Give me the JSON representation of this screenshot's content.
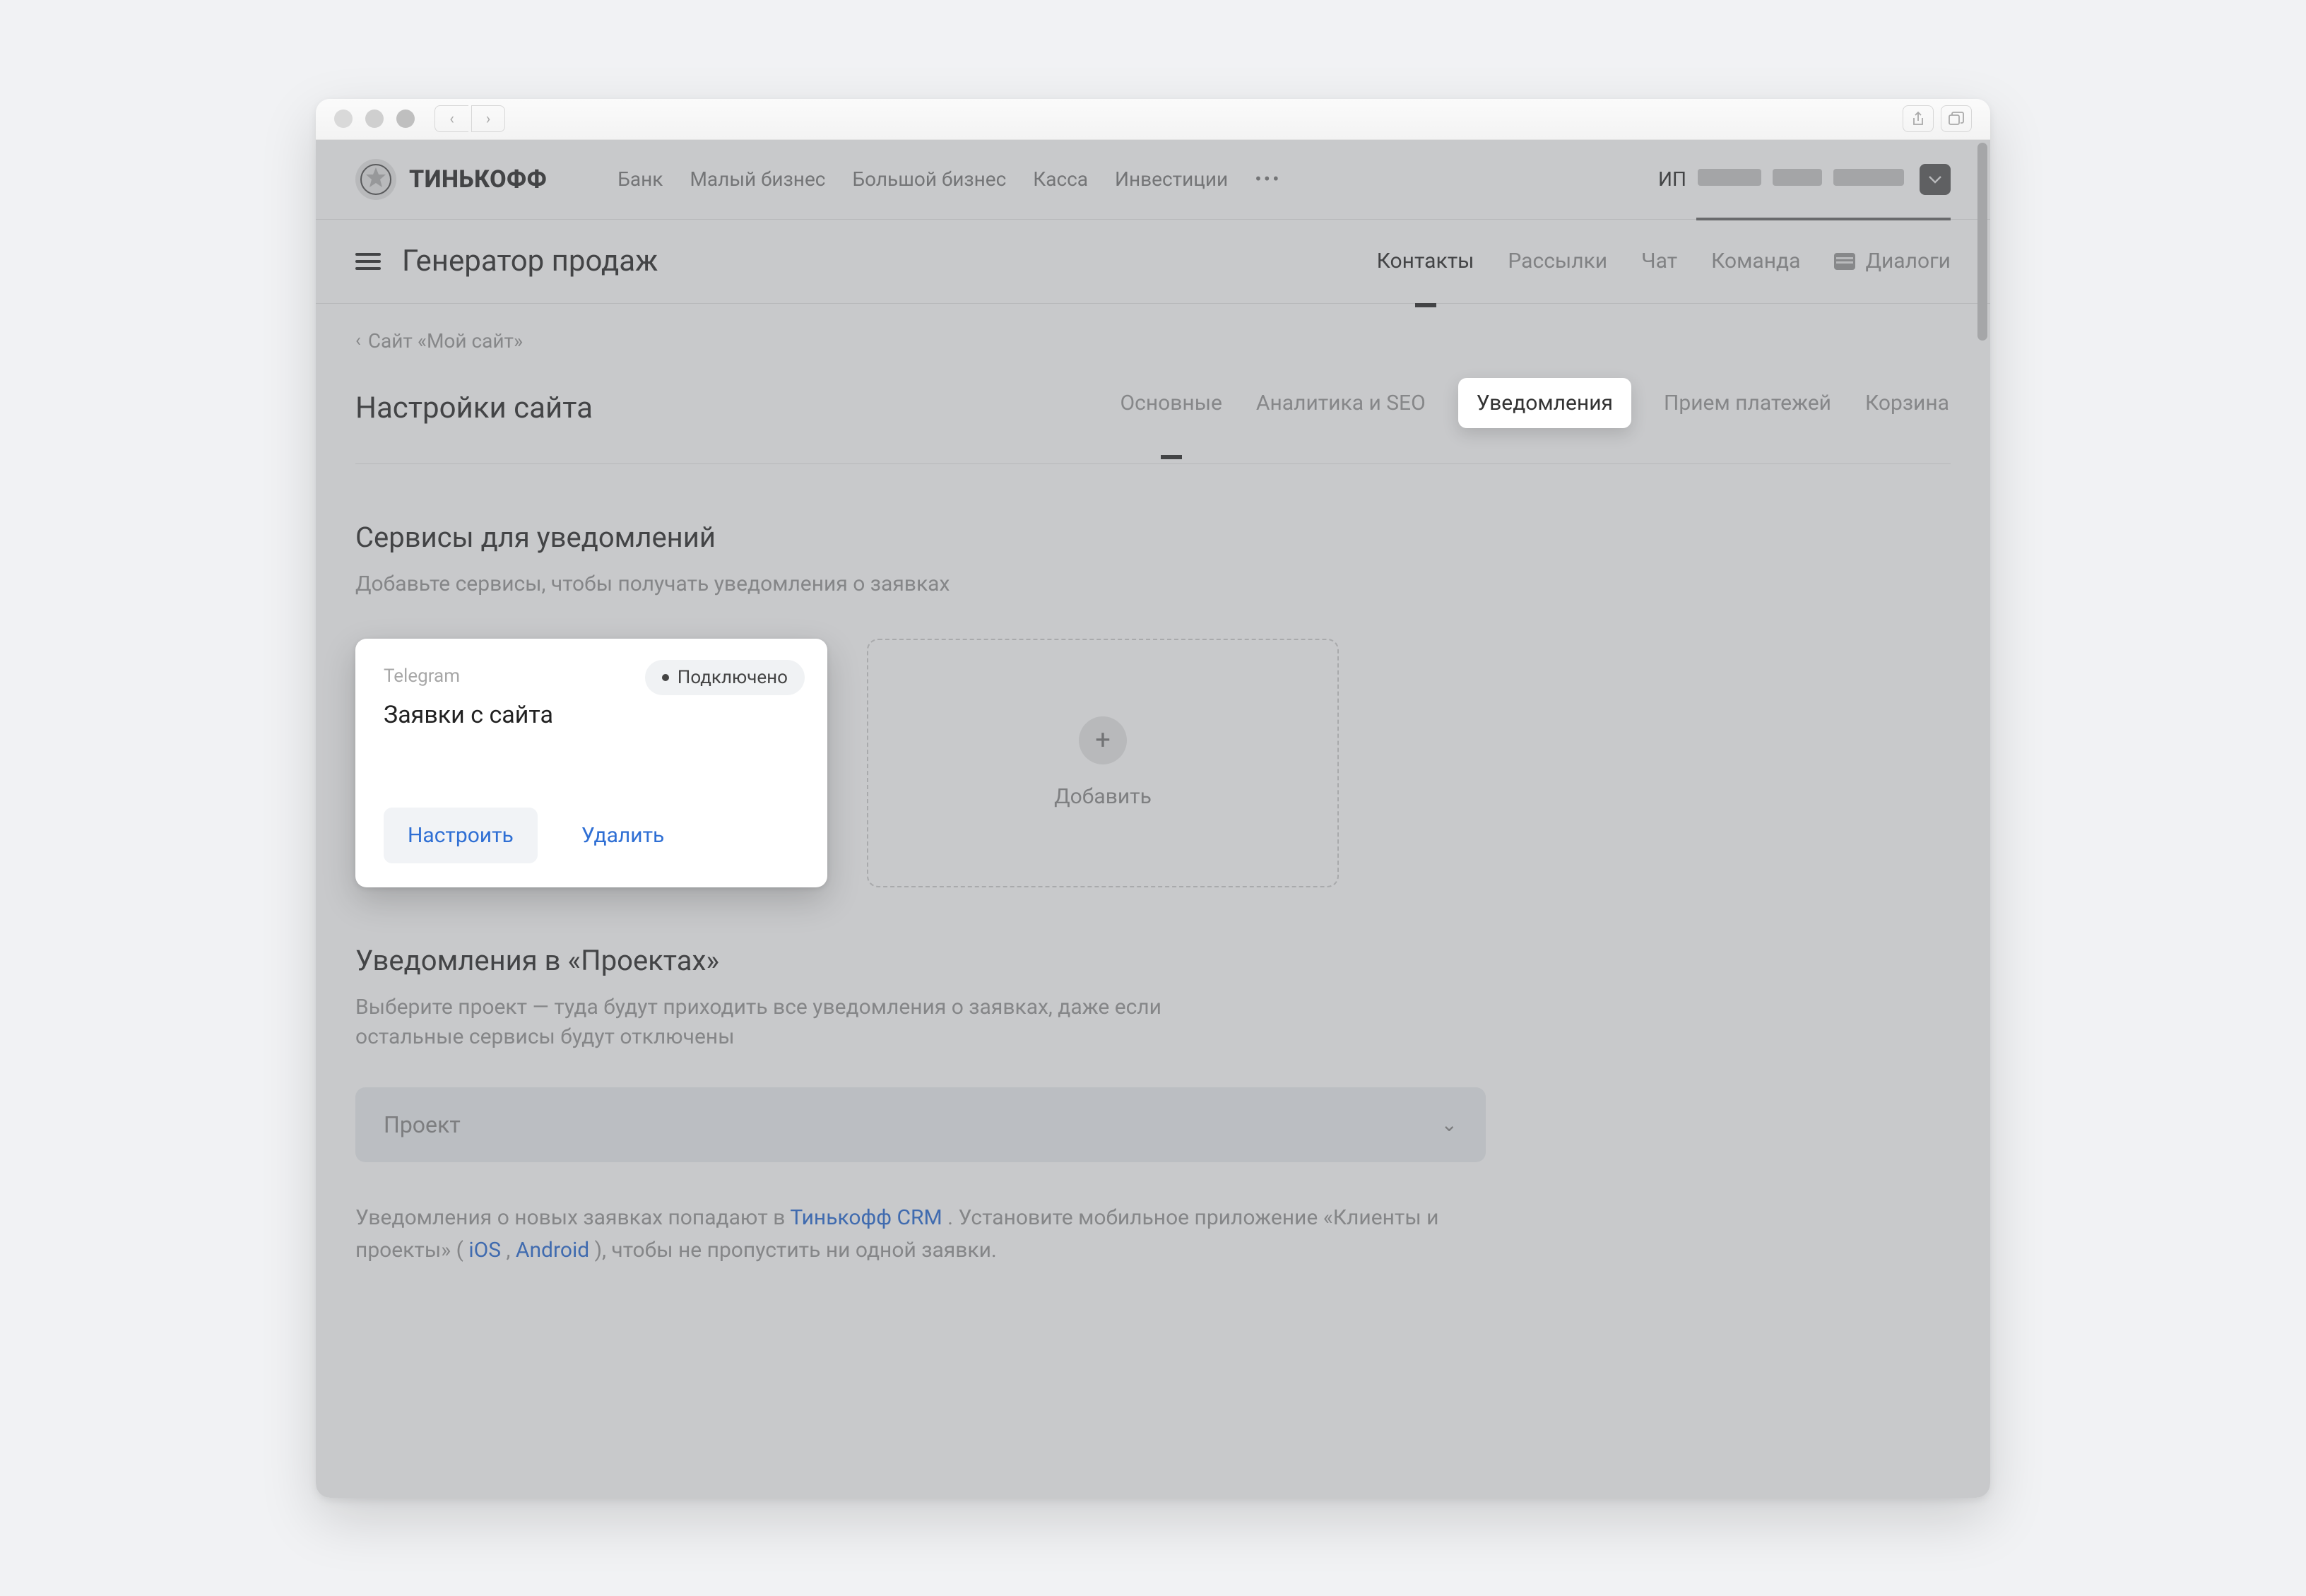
{
  "logo_text": "ТИНЬКОФФ",
  "top_nav": {
    "bank": "Банк",
    "small_biz": "Малый бизнес",
    "big_biz": "Большой бизнес",
    "kassa": "Касса",
    "invest": "Инвестиции",
    "more": "•••"
  },
  "account_prefix": "ИП",
  "second_header": {
    "title": "Генератор продаж",
    "tabs": {
      "contacts": "Контакты",
      "mailings": "Рассылки",
      "chat": "Чат",
      "team": "Команда",
      "dialogs": "Диалоги"
    }
  },
  "breadcrumb": "Сайт «Мой сайт»",
  "settings_title": "Настройки сайта",
  "settings_tabs": {
    "basic": "Основные",
    "analytics": "Аналитика и SEO",
    "notifications": "Уведомления",
    "payments": "Прием платежей",
    "cart": "Корзина"
  },
  "section_services": {
    "heading": "Сервисы для уведомлений",
    "desc": "Добавьте сервисы, чтобы получать уведомления о заявках"
  },
  "service_card": {
    "provider": "Telegram",
    "status": "Подключено",
    "title": "Заявки с сайта",
    "configure": "Настроить",
    "delete": "Удалить"
  },
  "add_card_label": "Добавить",
  "section_projects": {
    "heading": "Уведомления в «Проектах»",
    "desc": "Выберите проект — туда будут приходить все уведомления о заявках, даже если остальные сервисы будут отключены"
  },
  "project_select_placeholder": "Проект",
  "footnote": {
    "p1a": "Уведомления о новых заявках попадают в  ",
    "crm": "Тинькофф CRM",
    "p1b": ". Установите мобильное приложение «Клиенты и проекты» (",
    "ios": "iOS",
    "sep": ", ",
    "android": "Android",
    "p1c": "), чтобы не пропустить ни одной заявки."
  }
}
